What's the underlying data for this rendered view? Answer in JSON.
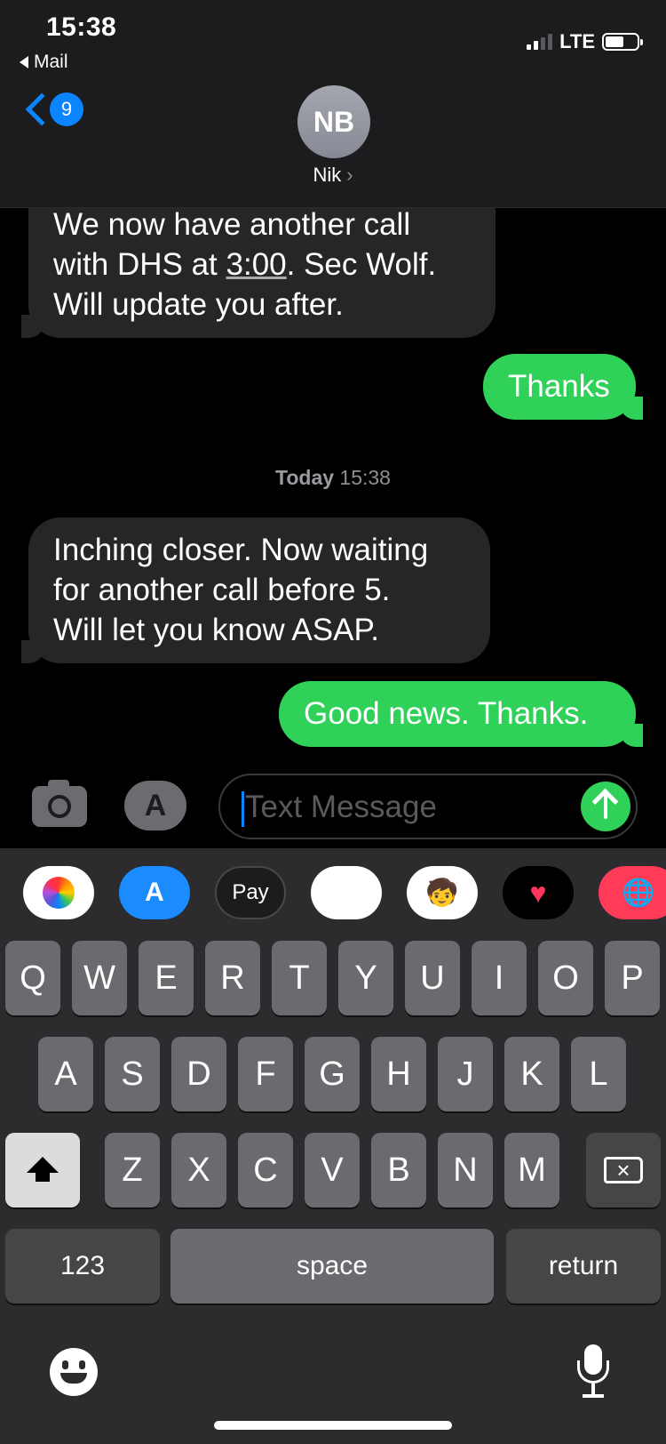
{
  "status_bar": {
    "time": "15:38",
    "back_app": "Mail",
    "carrier": "LTE"
  },
  "header": {
    "unread_count": "9",
    "avatar_initials": "NB",
    "contact_name": "Nik",
    "contact_chevron": "›"
  },
  "messages": [
    {
      "direction": "received",
      "lines": [
        "We now have another call",
        "with DHS at ",
        "3:00",
        ". Sec Wolf.",
        "Will update you after."
      ]
    },
    {
      "direction": "sent",
      "text": "Thanks"
    },
    {
      "direction": "received",
      "lines": [
        "Inching closer. Now waiting",
        "for another call before 5.",
        "Will let you know ASAP."
      ]
    },
    {
      "direction": "sent",
      "text": "Good news. Thanks."
    }
  ],
  "timestamp": {
    "day": "Today",
    "time": "15:38"
  },
  "input": {
    "placeholder": "Text Message"
  },
  "app_drawer": [
    {
      "name": "photos-app-icon"
    },
    {
      "name": "app-store-icon",
      "glyph": "A"
    },
    {
      "name": "apple-pay-icon",
      "label": "Pay",
      "glyph": ""
    },
    {
      "name": "animoji-icon",
      "glyph": "🐵"
    },
    {
      "name": "memoji-icon",
      "glyph": "🧒"
    },
    {
      "name": "digital-touch-icon",
      "glyph": "♥"
    },
    {
      "name": "image-search-icon",
      "glyph": "🌐"
    }
  ],
  "keyboard": {
    "row1": [
      "Q",
      "W",
      "E",
      "R",
      "T",
      "Y",
      "U",
      "I",
      "O",
      "P"
    ],
    "row2": [
      "A",
      "S",
      "D",
      "F",
      "G",
      "H",
      "J",
      "K",
      "L"
    ],
    "row3": [
      "Z",
      "X",
      "C",
      "V",
      "B",
      "N",
      "M"
    ],
    "numbers_label": "123",
    "space_label": "space",
    "return_label": "return"
  }
}
